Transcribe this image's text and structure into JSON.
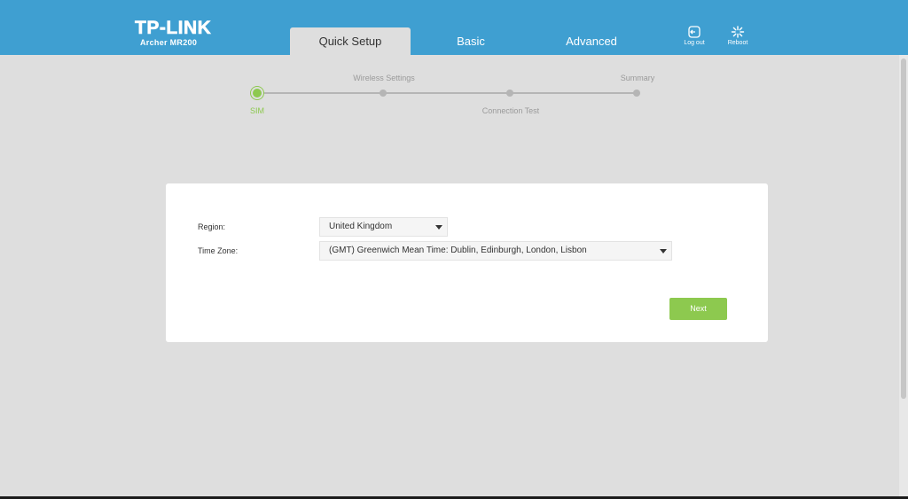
{
  "brand": {
    "logo": "TP-LINK",
    "model": "Archer MR200"
  },
  "tabs": [
    {
      "label": "Quick Setup",
      "active": true
    },
    {
      "label": "Basic",
      "active": false
    },
    {
      "label": "Advanced",
      "active": false
    }
  ],
  "header_actions": {
    "logout": {
      "label": "Log out",
      "icon": "logout-icon"
    },
    "reboot": {
      "label": "Reboot",
      "icon": "reboot-icon"
    }
  },
  "progress": {
    "steps": [
      {
        "label": "SIM",
        "active": true
      },
      {
        "label": "Wireless Settings",
        "active": false
      },
      {
        "label": "Connection Test",
        "active": false
      },
      {
        "label": "Summary",
        "active": false
      }
    ]
  },
  "form": {
    "region": {
      "label": "Region:",
      "value": "United Kingdom"
    },
    "timezone": {
      "label": "Time Zone:",
      "value": "(GMT) Greenwich Mean Time: Dublin, Edinburgh, London, Lisbon"
    },
    "next_label": "Next"
  },
  "colors": {
    "header": "#3f9fd1",
    "accent_green": "#8dc94f",
    "background": "#dedede"
  }
}
